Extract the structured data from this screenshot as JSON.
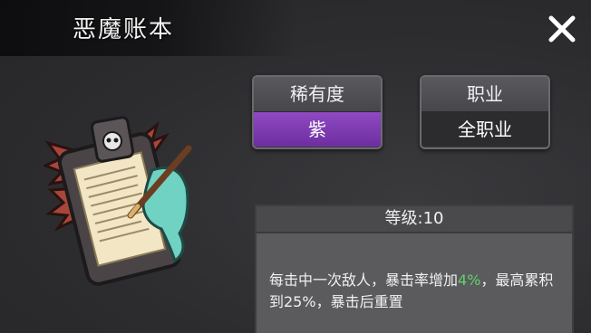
{
  "title": "恶魔账本",
  "rarity": {
    "label": "稀有度",
    "value": "紫"
  },
  "job": {
    "label": "职业",
    "value": "全职业"
  },
  "level_text": "等级:10",
  "description": {
    "part1": "每击中一次敌人，暴击率增加",
    "highlight": "4%",
    "part2": "，最高累积到25%，暴击后重置"
  },
  "icons": {
    "close": "close-x-icon",
    "item": "demon-ledger-item-icon"
  },
  "colors": {
    "rarity_purple": "#7f3db5",
    "highlight_green": "#5fd36a"
  }
}
